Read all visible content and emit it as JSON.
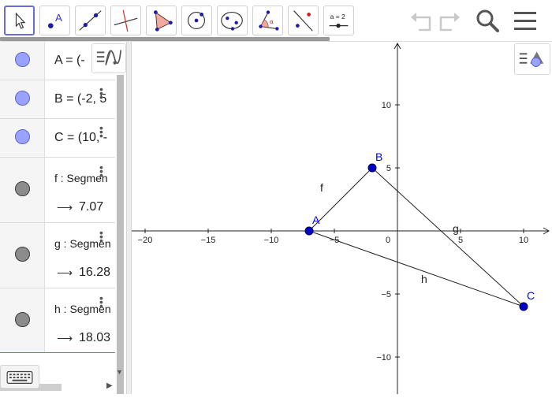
{
  "toolbar": {
    "tools": [
      {
        "name": "move-tool",
        "icon": "cursor-arrow-icon",
        "active": true
      },
      {
        "name": "point-tool",
        "icon": "point-icon",
        "label": "A"
      },
      {
        "name": "line-tool",
        "icon": "line-through-points-icon"
      },
      {
        "name": "perpendicular-line-tool",
        "icon": "perpendicular-icon"
      },
      {
        "name": "polygon-tool",
        "icon": "polygon-icon"
      },
      {
        "name": "circle-tool",
        "icon": "circle-center-point-icon"
      },
      {
        "name": "ellipse-tool",
        "icon": "ellipse-icon"
      },
      {
        "name": "angle-tool",
        "icon": "angle-icon",
        "label": "α"
      },
      {
        "name": "reflect-tool",
        "icon": "reflect-about-line-icon"
      },
      {
        "name": "slider-tool",
        "icon": "slider-icon",
        "label": "a = 2"
      }
    ],
    "undo_icon": "undo-icon",
    "redo_icon": "redo-icon",
    "search_icon": "search-icon",
    "menu_icon": "hamburger-menu-icon"
  },
  "algebra": {
    "items": [
      {
        "kind": "point",
        "text": "A = (-",
        "color": "#9aa2ff"
      },
      {
        "kind": "point",
        "text": "B = (-2, 5",
        "color": "#9aa2ff"
      },
      {
        "kind": "point",
        "text": "C = (10, -",
        "color": "#9aa2ff"
      },
      {
        "kind": "segment",
        "text": "f : Segmen",
        "value": "7.07"
      },
      {
        "kind": "segment",
        "text": "g : Segmen",
        "value": "16.28"
      },
      {
        "kind": "segment",
        "text": "h : Segmen",
        "value": "18.03"
      }
    ],
    "arrow": "⟶",
    "keyboard_icon": "keyboard-icon",
    "style_icon": "algebra-style-icon"
  },
  "graphics": {
    "style_icon": "graphics-style-icon",
    "x_ticks": [
      "−20",
      "−15",
      "−10",
      "−5",
      "0",
      "5",
      "10"
    ],
    "y_ticks": [
      "10",
      "5",
      "−5",
      "−10"
    ],
    "points": [
      {
        "label": "A",
        "x": -7,
        "y": 0
      },
      {
        "label": "B",
        "x": -2,
        "y": 5
      },
      {
        "label": "C",
        "x": 10,
        "y": -6
      }
    ],
    "segments": [
      {
        "label": "f",
        "from": "A",
        "to": "B"
      },
      {
        "label": "g",
        "from": "B",
        "to": "C"
      },
      {
        "label": "h",
        "from": "A",
        "to": "C"
      }
    ],
    "colors": {
      "point": "#0000cc",
      "point_label": "#0000ff",
      "axis": "#222222"
    }
  }
}
